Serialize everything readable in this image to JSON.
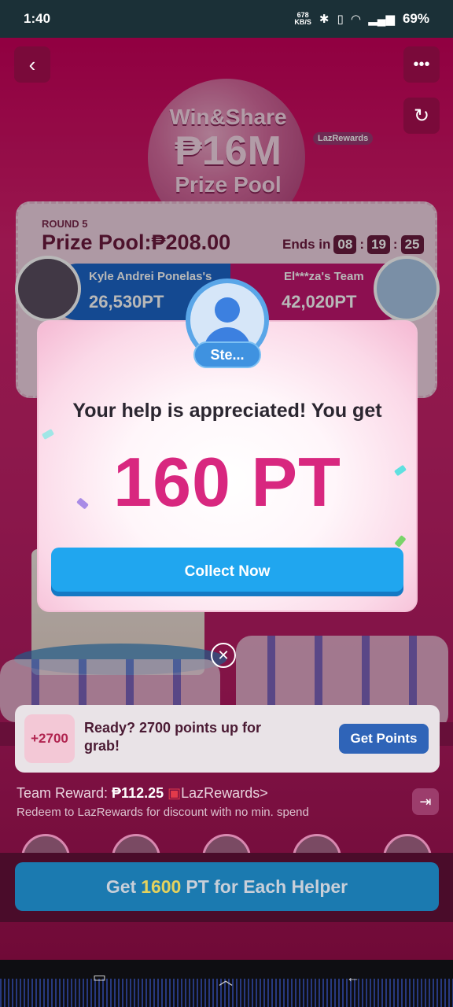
{
  "status_bar": {
    "time": "1:40",
    "net_speed": "678",
    "net_unit": "KB/S",
    "battery": "69%"
  },
  "header": {
    "back_icon": "chevron-left-icon",
    "more_icon": "more-icon",
    "refresh_icon": "refresh-icon",
    "title_line1": "Win&Share",
    "title_line2": "₱16M",
    "title_line3": "Prize Pool",
    "brand_badge": "LazRewards"
  },
  "round": {
    "label": "ROUND 5",
    "prize": "Prize Pool:₱208.00",
    "ends_label": "Ends in",
    "hours": "08",
    "minutes": "19",
    "seconds": "25",
    "team_left_name": "Kyle Andrei Ponelas's",
    "team_left_points": "26,530PT",
    "team_right_name": "El***za's Team",
    "team_right_points": "42,020PT"
  },
  "modal": {
    "user_name": "Ste...",
    "message": "Your help is appreciated! You get",
    "points": "160 PT",
    "collect_label": "Collect Now",
    "close_icon": "close-icon"
  },
  "ready_card": {
    "badge": "+2700",
    "text": "Ready? 2700 points up for grab!",
    "button": "Get Points"
  },
  "team_reward": {
    "label": "Team Reward: ",
    "amount": "₱112.25",
    "link": "LazRewards>",
    "subtext": "Redeem to LazRewards for discount with no min. spend"
  },
  "bottom_button": {
    "prefix": "Get",
    "highlight": "1600",
    "suffix": "PT for Each Helper"
  }
}
